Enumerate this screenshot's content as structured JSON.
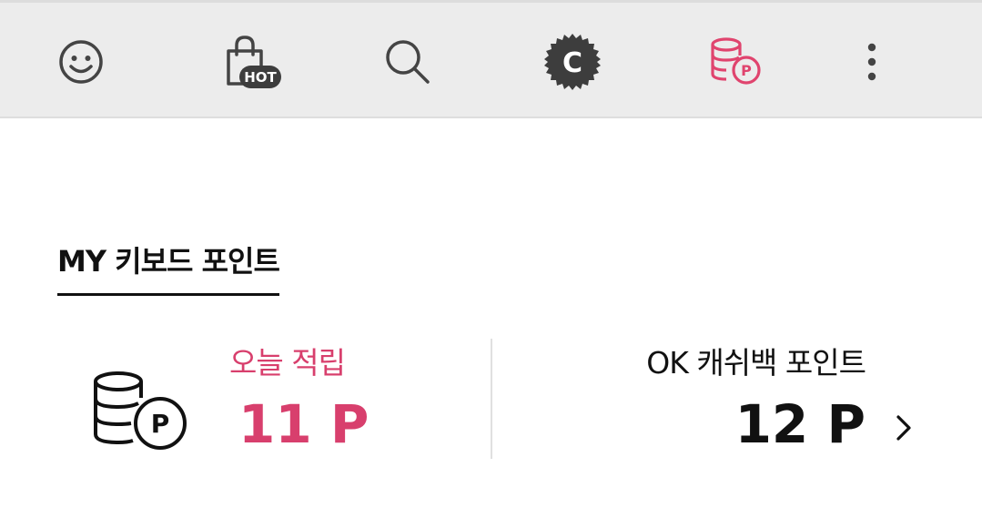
{
  "toolbar": {
    "emoji_icon": "smiley-icon",
    "hot_icon": "shopping-bag-hot-icon",
    "hot_badge": "HOT",
    "search_icon": "search-icon",
    "cash_icon": "c-badge-icon",
    "cash_badge_letter": "C",
    "points_icon": "coin-stack-points-icon",
    "more_icon": "more-vertical-icon",
    "accent_color": "#e0446e",
    "icon_color": "#444444"
  },
  "section": {
    "title": "MY 키보드 포인트"
  },
  "today": {
    "icon": "coin-stack-points-icon",
    "icon_letter": "P",
    "label": "오늘 적립",
    "value": "11 P",
    "color": "#d83f6d"
  },
  "okcashbag": {
    "label": "OK 캐쉬백 포인트",
    "value": "12 P",
    "chevron_icon": "chevron-right-icon"
  }
}
